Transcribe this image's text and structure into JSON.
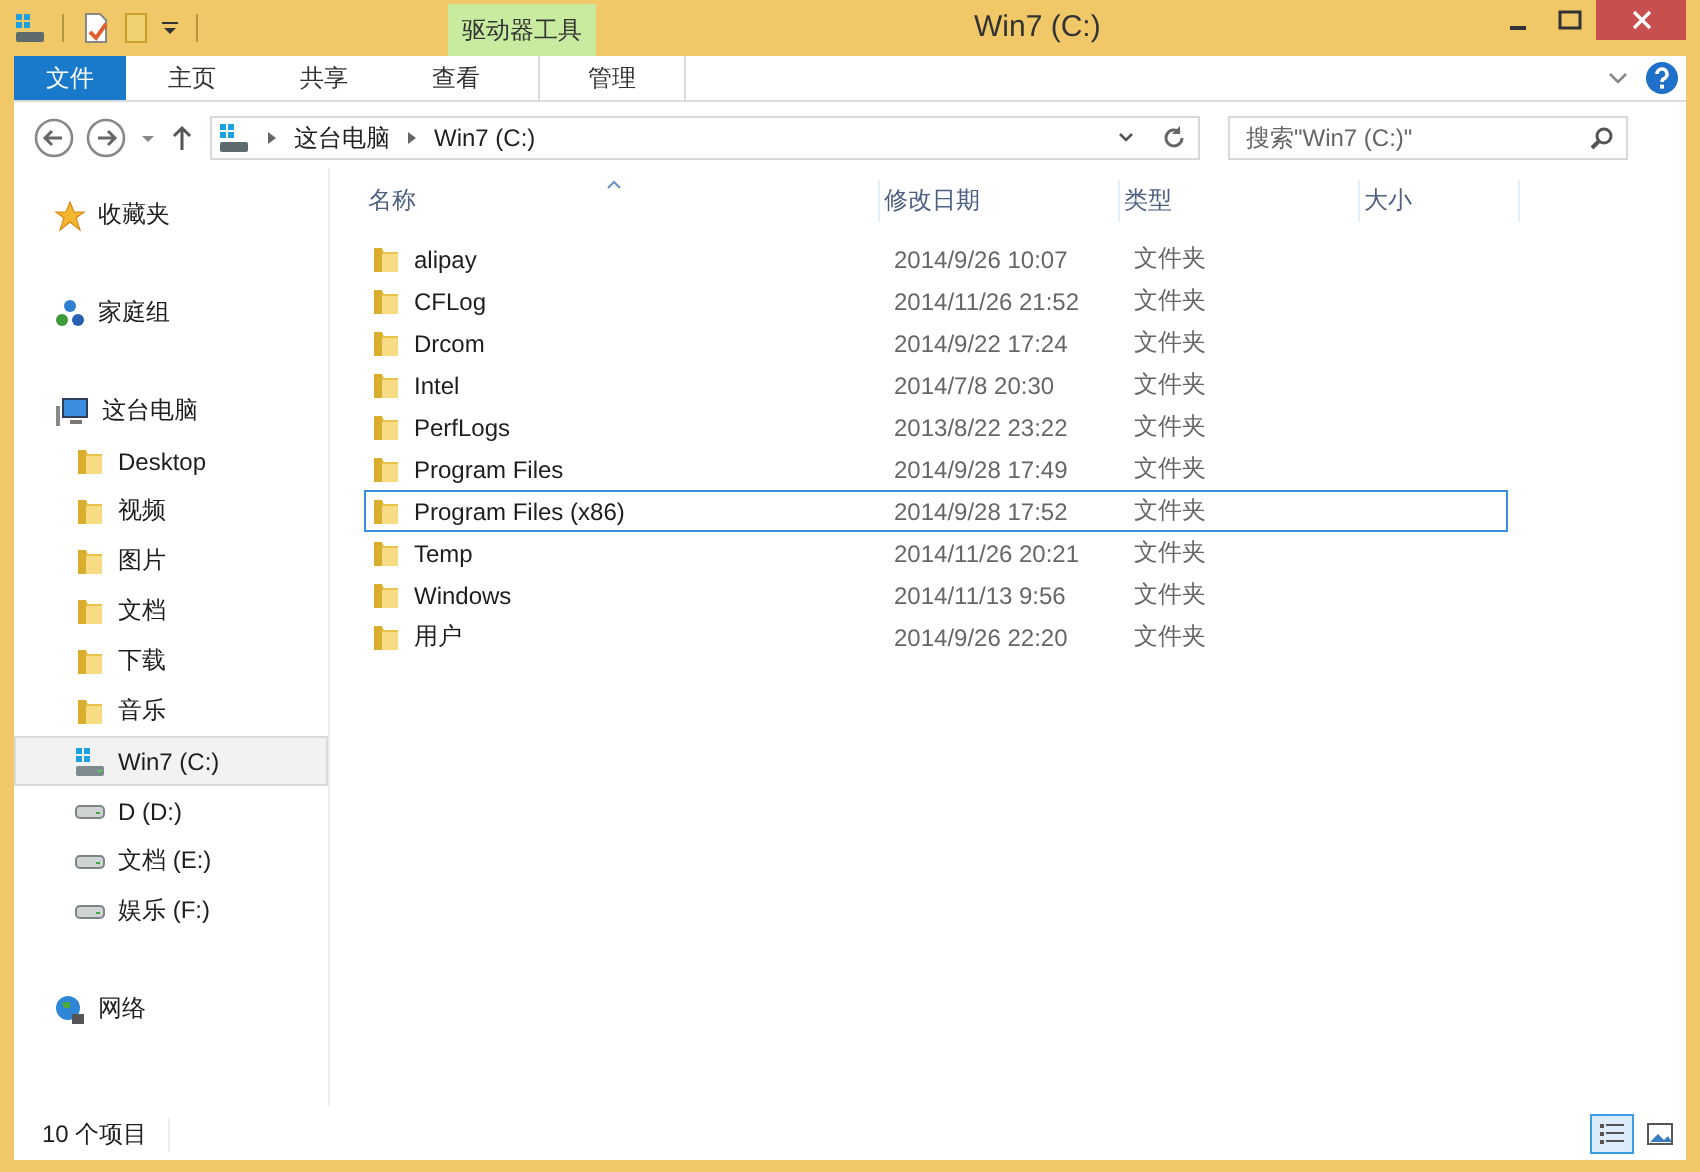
{
  "window": {
    "title": "Win7 (C:)"
  },
  "ribbon": {
    "tabs": [
      {
        "label": "文件",
        "kind": "file"
      },
      {
        "label": "主页",
        "kind": "plain"
      },
      {
        "label": "共享",
        "kind": "plain"
      },
      {
        "label": "查看",
        "kind": "plain"
      },
      {
        "label": "管理",
        "kind": "context",
        "group": "驱动器工具"
      }
    ]
  },
  "address": {
    "path": [
      "这台电脑",
      "Win7 (C:)"
    ]
  },
  "search": {
    "placeholder": "搜索\"Win7 (C:)\""
  },
  "sidebar": {
    "items": [
      {
        "label": "收藏夹",
        "kind": "favorites",
        "selected": false
      },
      {
        "label": "家庭组",
        "kind": "homegroup",
        "selected": false
      },
      {
        "label": "这台电脑",
        "kind": "pc",
        "selected": false,
        "children": [
          {
            "label": "Desktop",
            "kind": "folder",
            "selected": false
          },
          {
            "label": "视频",
            "kind": "folder",
            "selected": false
          },
          {
            "label": "图片",
            "kind": "folder",
            "selected": false
          },
          {
            "label": "文档",
            "kind": "folder",
            "selected": false
          },
          {
            "label": "下载",
            "kind": "folder",
            "selected": false
          },
          {
            "label": "音乐",
            "kind": "folder",
            "selected": false
          },
          {
            "label": "Win7 (C:)",
            "kind": "system-drive",
            "selected": true
          },
          {
            "label": "D  (D:)",
            "kind": "drive",
            "selected": false
          },
          {
            "label": "文档 (E:)",
            "kind": "drive",
            "selected": false
          },
          {
            "label": "娱乐 (F:)",
            "kind": "drive",
            "selected": false
          }
        ]
      },
      {
        "label": "网络",
        "kind": "network",
        "selected": false
      }
    ]
  },
  "table": {
    "columns": [
      "名称",
      "修改日期",
      "类型",
      "大小"
    ],
    "rows": [
      {
        "name": "alipay",
        "date": "2014/9/26 10:07",
        "type": "文件夹",
        "focused": false
      },
      {
        "name": "CFLog",
        "date": "2014/11/26 21:52",
        "type": "文件夹",
        "focused": false
      },
      {
        "name": "Drcom",
        "date": "2014/9/22 17:24",
        "type": "文件夹",
        "focused": false
      },
      {
        "name": "Intel",
        "date": "2014/7/8 20:30",
        "type": "文件夹",
        "focused": false
      },
      {
        "name": "PerfLogs",
        "date": "2013/8/22 23:22",
        "type": "文件夹",
        "focused": false
      },
      {
        "name": "Program Files",
        "date": "2014/9/28 17:49",
        "type": "文件夹",
        "focused": false
      },
      {
        "name": "Program Files (x86)",
        "date": "2014/9/28 17:52",
        "type": "文件夹",
        "focused": true
      },
      {
        "name": "Temp",
        "date": "2014/11/26 20:21",
        "type": "文件夹",
        "focused": false
      },
      {
        "name": "Windows",
        "date": "2014/11/13 9:56",
        "type": "文件夹",
        "focused": false
      },
      {
        "name": "用户",
        "date": "2014/9/26 22:20",
        "type": "文件夹",
        "focused": false
      }
    ]
  },
  "status_bar": {
    "count": "10 个项目"
  }
}
